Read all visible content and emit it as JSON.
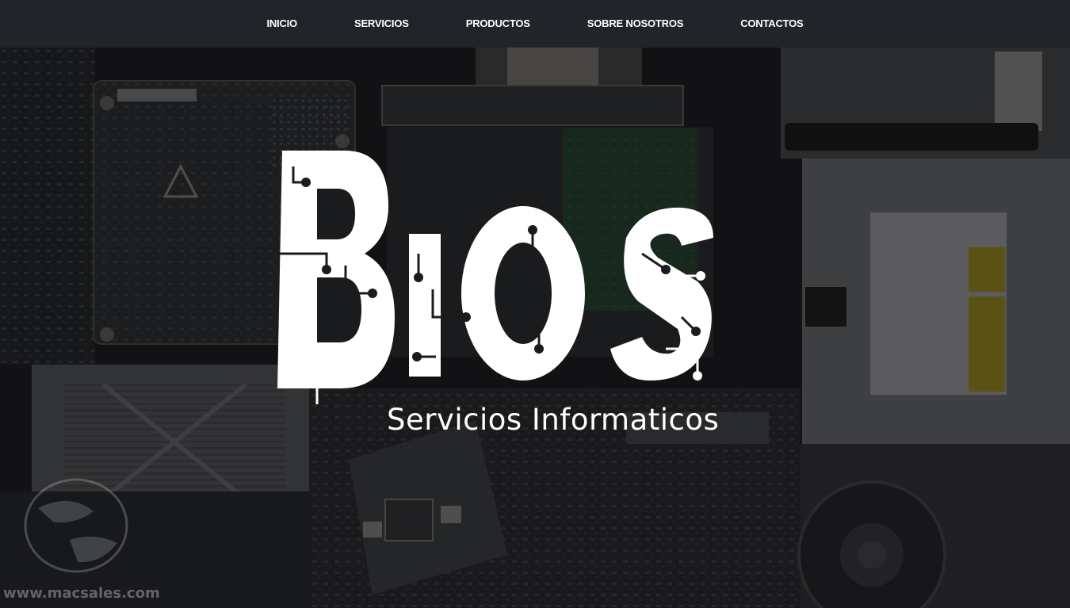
{
  "nav": {
    "items": [
      {
        "label": "INICIO"
      },
      {
        "label": "SERVICIOS"
      },
      {
        "label": "PRODUCTOS"
      },
      {
        "label": "SOBRE NOSOTROS"
      },
      {
        "label": "CONTACTOS"
      }
    ]
  },
  "hero": {
    "logo_text": "BIOS",
    "subtitle": "Servicios Informaticos",
    "watermark": "www.macsales.com"
  },
  "colors": {
    "nav_bg": "#212529",
    "nav_text": "#ffffff",
    "logo": "#ffffff"
  }
}
